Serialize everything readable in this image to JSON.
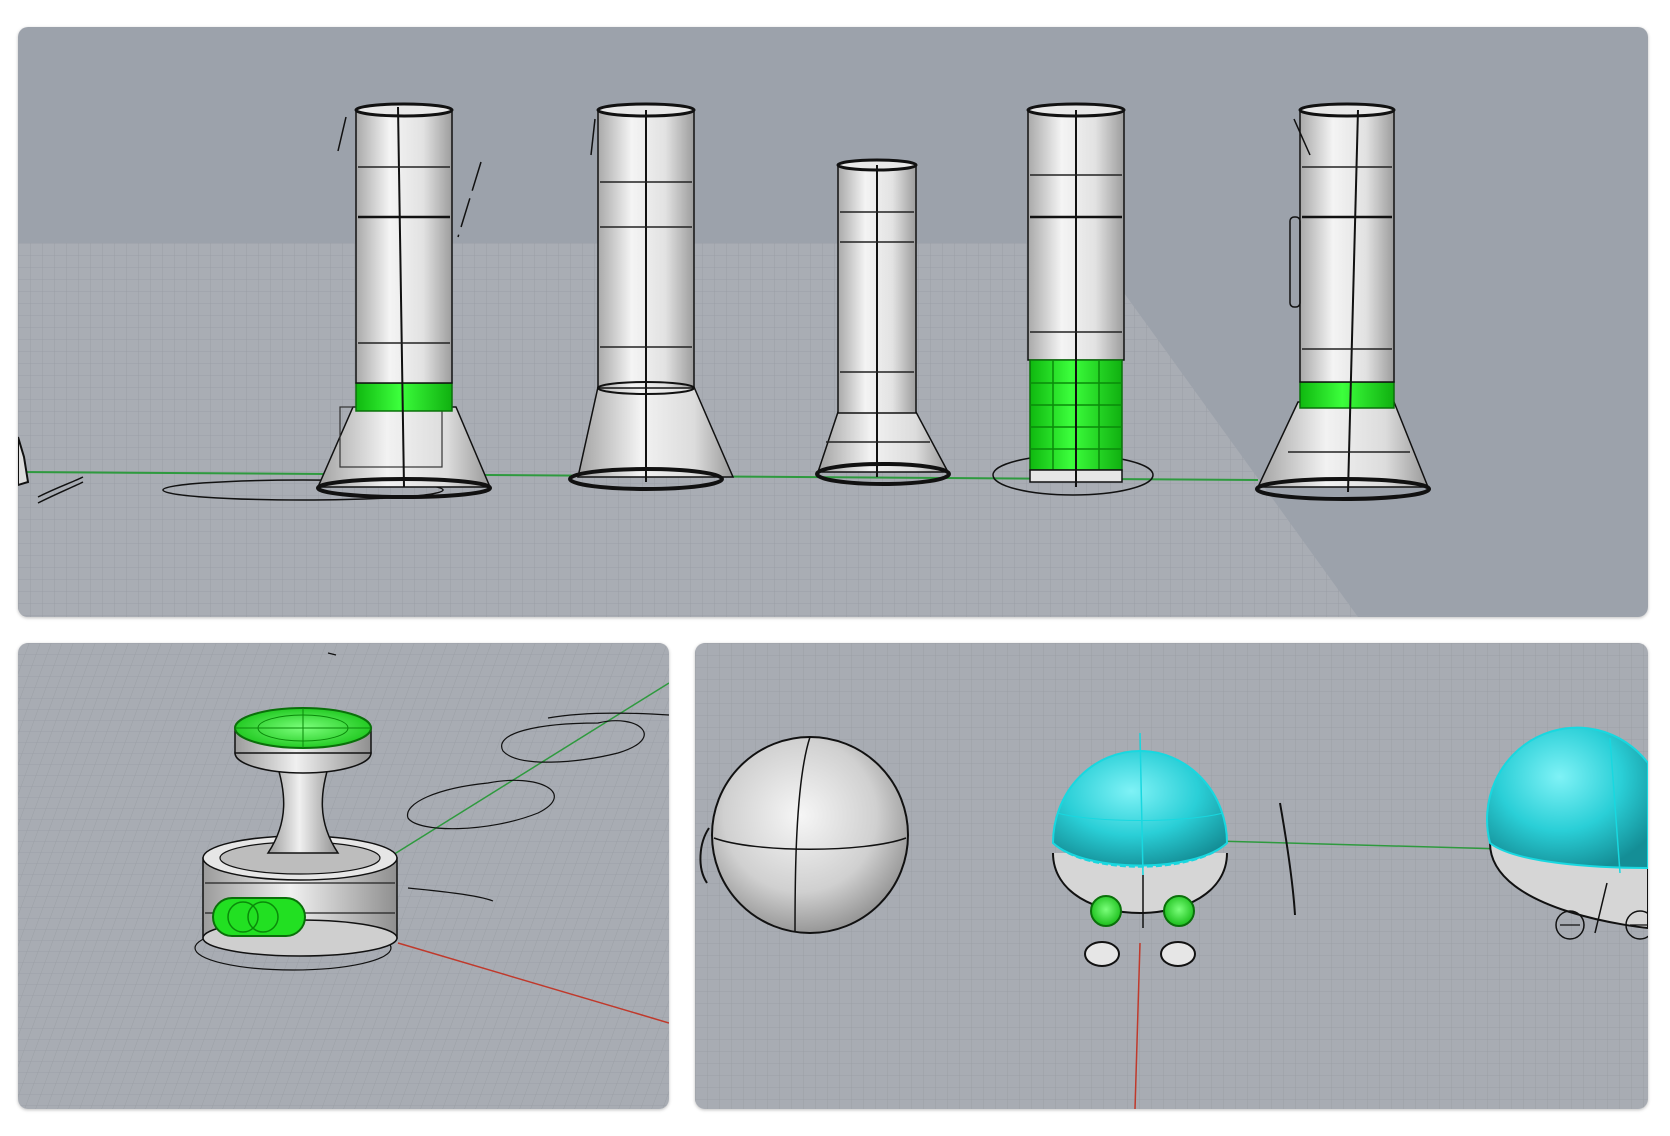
{
  "colors": {
    "background": "#9ca2ab",
    "grid_floor": "#a8acb3",
    "grid_line": "#979ca3",
    "selection_green": "#19e619",
    "selection_cyan": "#2ad0d8",
    "x_axis": "#c0392b",
    "y_axis": "#2e9a3e",
    "surface_light": "#eeeeee",
    "surface_dark": "#9a9a9a",
    "wire": "#111111"
  },
  "viewports": [
    {
      "id": "top",
      "content": "five-flashlight-models-perspective"
    },
    {
      "id": "bottom-left",
      "content": "stamp-handle-model-perspective"
    },
    {
      "id": "bottom-right",
      "content": "sphere-robot-models-perspective"
    }
  ]
}
